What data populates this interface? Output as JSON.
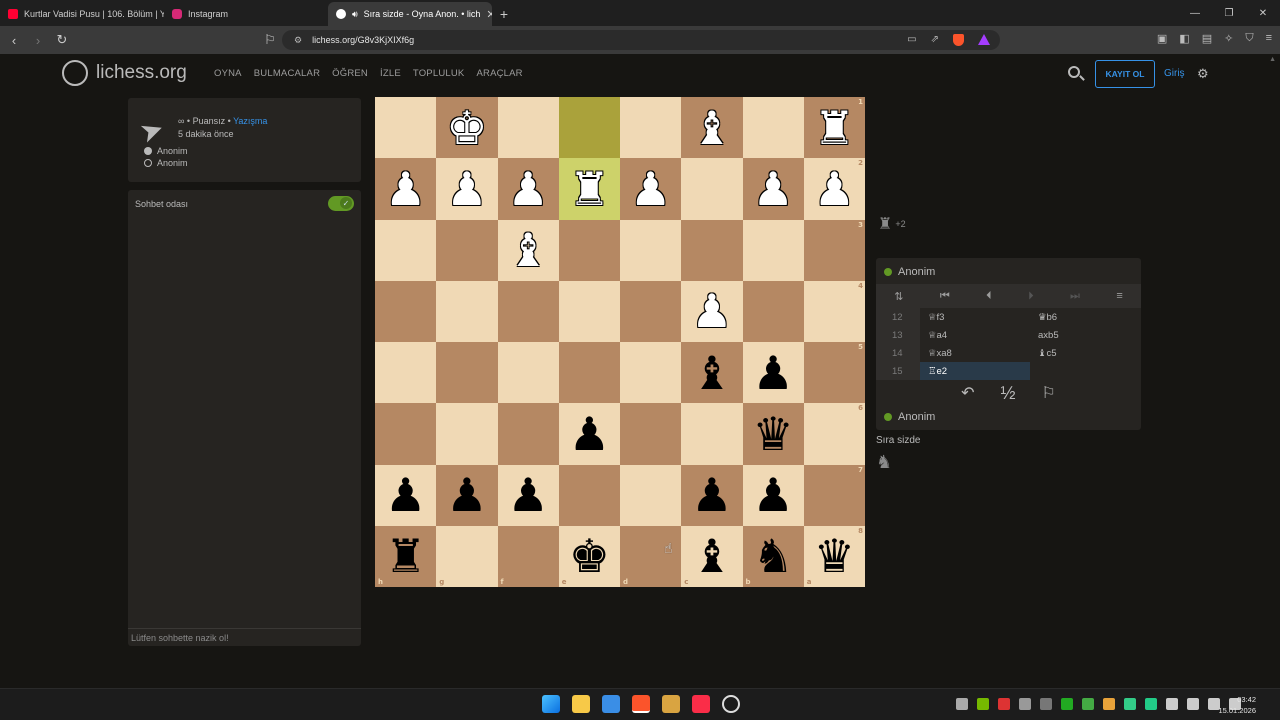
{
  "browser": {
    "tabs": [
      {
        "title": "Kurtlar Vadisi Pusu | 106. Bölüm | Yüks",
        "icon_color": "#ff0033",
        "active": false
      },
      {
        "title": "Instagram",
        "icon_color": "#d62976",
        "active": false
      },
      {
        "title": "Sıra sizde - Oyna Anon. • lich",
        "icon_color": "#ffffff",
        "active": true
      }
    ],
    "url": "lichess.org/G8v3KjXIXf6g"
  },
  "header": {
    "logo_text": "lichess.org",
    "nav": [
      "OYNA",
      "BULMACALAR",
      "ÖĞREN",
      "İZLE",
      "TOPLULUK",
      "ARAÇLAR"
    ],
    "signup_label": "KAYIT OL",
    "signin_label": "Giriş"
  },
  "game_info": {
    "line1_prefix": "∞ • Puansız • ",
    "line1_link": "Yazışma",
    "line2": "5 dakika önce",
    "player_white": "Anonim",
    "player_black": "Anonim"
  },
  "chat": {
    "title": "Sohbet odası",
    "toggle_on": true,
    "placeholder": "Lütfen sohbette nazik ol!"
  },
  "board": {
    "orientation": "black",
    "rows": [
      [
        "",
        "wK",
        "",
        "",
        "",
        "wB",
        "",
        "wR"
      ],
      [
        "wP",
        "wP",
        "wP",
        "wR",
        "wP",
        "",
        "wP",
        "wP"
      ],
      [
        "",
        "",
        "wB",
        "",
        "",
        "",
        "",
        ""
      ],
      [
        "",
        "",
        "",
        "",
        "",
        "wP",
        "",
        ""
      ],
      [
        "",
        "",
        "",
        "",
        "",
        "bB",
        "bP",
        ""
      ],
      [
        "",
        "",
        "",
        "bP",
        "",
        "",
        "bQ",
        ""
      ],
      [
        "bP",
        "bP",
        "bP",
        "",
        "",
        "bP",
        "bP",
        ""
      ],
      [
        "bR",
        "",
        "",
        "bK",
        "",
        "bB",
        "bN",
        "bQ"
      ]
    ],
    "highlight": [
      [
        0,
        3
      ],
      [
        1,
        3
      ]
    ],
    "ranks": [
      "1",
      "2",
      "3",
      "4",
      "5",
      "6",
      "7",
      "8"
    ],
    "files": [
      "h",
      "g",
      "f",
      "e",
      "d",
      "c",
      "b",
      "a"
    ]
  },
  "side": {
    "material_diff": "+2",
    "top_player": "Anonim",
    "bottom_player": "Anonim",
    "moves": [
      {
        "n": "12",
        "w": "♕f3",
        "b": "♛b6"
      },
      {
        "n": "13",
        "w": "♕a4",
        "b": "axb5"
      },
      {
        "n": "14",
        "w": "♕xa8",
        "b": "♝c5"
      },
      {
        "n": "15",
        "w": "♖e2",
        "b": ""
      }
    ],
    "draw_label": "½",
    "turn_text": "Sıra sizde"
  },
  "taskbar": {
    "time": "03:42",
    "date": "15.01.2026"
  }
}
